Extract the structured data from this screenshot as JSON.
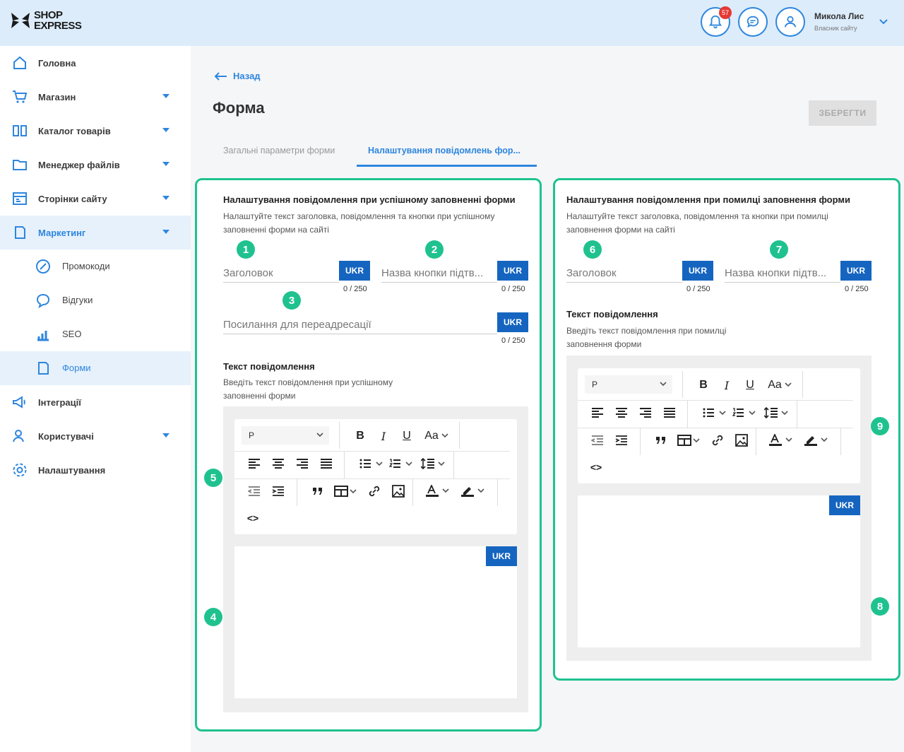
{
  "header": {
    "logo_line1": "SHOP",
    "logo_line2": "EXPRESS",
    "notifications_count": "57",
    "user_name": "Микола Лис",
    "user_role": "Власник сайту"
  },
  "sidebar": {
    "items": [
      {
        "label": "Головна",
        "icon": "home-icon"
      },
      {
        "label": "Магазин",
        "icon": "cart-icon"
      },
      {
        "label": "Каталог товарів",
        "icon": "catalog-icon"
      },
      {
        "label": "Менеджер файлів",
        "icon": "folder-icon"
      },
      {
        "label": "Сторінки сайту",
        "icon": "pages-icon"
      },
      {
        "label": "Маркетинг",
        "icon": "marketing-icon"
      },
      {
        "label": "Інтеграції",
        "icon": "megaphone-icon"
      },
      {
        "label": "Користувачі",
        "icon": "users-icon"
      },
      {
        "label": "Налаштування",
        "icon": "settings-icon"
      }
    ],
    "subitems": [
      {
        "label": "Промокоди",
        "icon": "promo-icon"
      },
      {
        "label": "Відгуки",
        "icon": "reviews-icon"
      },
      {
        "label": "SEO",
        "icon": "seo-icon"
      },
      {
        "label": "Форми",
        "icon": "forms-icon"
      }
    ]
  },
  "main": {
    "back_label": "Назад",
    "title": "Форма",
    "save_label": "ЗБЕРЕГТИ",
    "tabs": [
      "Загальні параметри форми",
      "Налаштування повідомлень фор..."
    ]
  },
  "success_card": {
    "title": "Налаштування повідомлення при успішному заповненні форми",
    "desc1": "Налаштуйте текст заголовка, повідомлення та кнопки при успішному",
    "desc2": "заповненні форми на сайті",
    "heading_ph": "Заголовок",
    "button_ph": "Назва кнопки підтв...",
    "redirect_ph": "Посилання для переадресації",
    "counter": "0 / 250",
    "lang": "UKR",
    "msg_title": "Текст повідомлення",
    "msg_desc1": "Введіть текст повідомлення при успішному",
    "msg_desc2": "заповненні форми"
  },
  "error_card": {
    "title": "Налаштування повідомлення при помилці заповнення форми",
    "desc1": "Налаштуйте текст заголовка, повідомлення та кнопки при помилці",
    "desc2": "заповнення форми на сайті",
    "heading_ph": "Заголовок",
    "button_ph": "Назва кнопки підтв...",
    "counter": "0 / 250",
    "lang": "UKR",
    "msg_title": "Текст повідомлення",
    "msg_desc1": "Введіть текст повідомлення при помилці",
    "msg_desc2": "заповнення форми"
  },
  "editor": {
    "paragraph": "P",
    "font_size": "Aa",
    "code": "<>"
  },
  "markers": [
    "1",
    "2",
    "3",
    "4",
    "5",
    "6",
    "7",
    "8",
    "9"
  ],
  "colors": {
    "accent": "#2e86de",
    "marker": "#1fc28f",
    "lang_badge": "#1565c0"
  }
}
